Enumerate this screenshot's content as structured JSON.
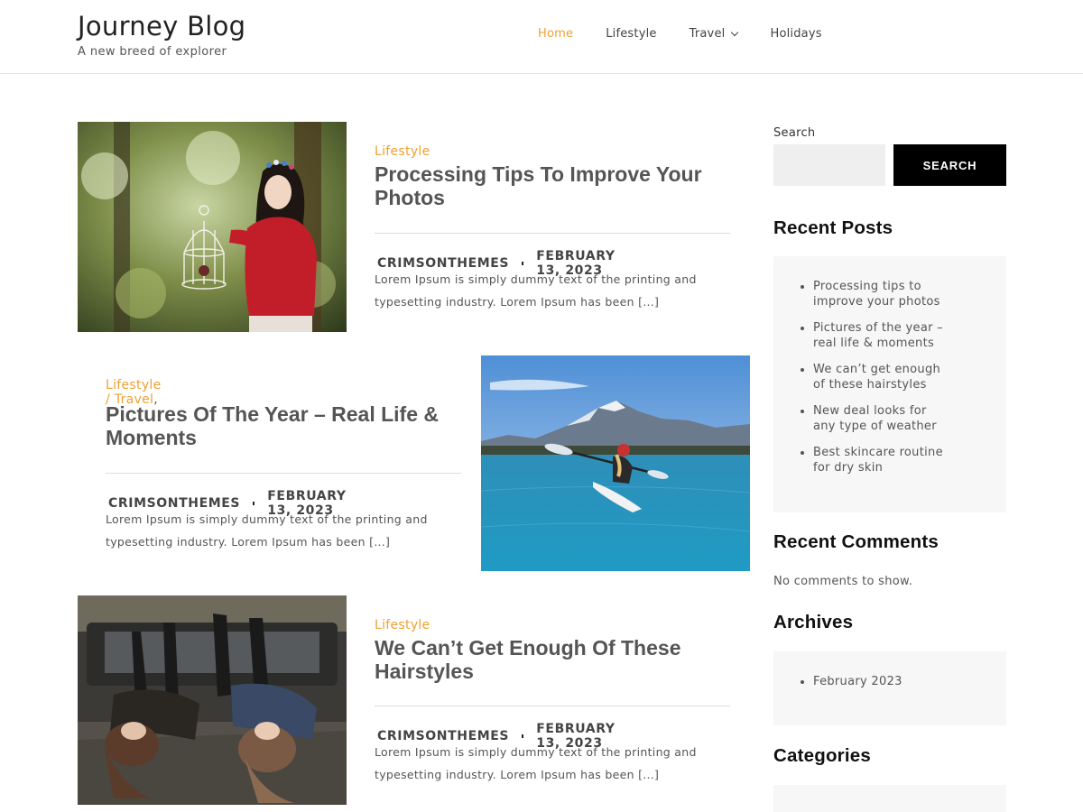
{
  "header": {
    "site_title": "Journey Blog",
    "tagline": "A new breed of explorer",
    "nav": [
      {
        "label": "Home",
        "active": true
      },
      {
        "label": "Lifestyle"
      },
      {
        "label": "Travel",
        "has_dropdown": true
      },
      {
        "label": "Holidays"
      }
    ],
    "accent_color": "#f0a030"
  },
  "posts": [
    {
      "categories": [
        "Lifestyle"
      ],
      "title": "Processing Tips To Improve Your Photos",
      "author": "CRIMSONTHEMES",
      "date": "FEBRUARY 13, 2023",
      "excerpt": "Lorem Ipsum is simply dummy text of the printing and typesetting industry. Lorem Ipsum has been […]",
      "image": "girl-with-birdcage-forest"
    },
    {
      "categories": [
        "Lifestyle",
        "Travel"
      ],
      "category_separator": " / ",
      "category_trailing": ",",
      "title": "Pictures Of The Year – Real Life & Moments",
      "author": "CRIMSONTHEMES",
      "date": "FEBRUARY 13, 2023",
      "excerpt": "Lorem Ipsum is simply dummy text of the printing and typesetting industry. Lorem Ipsum has been […]",
      "image": "kayak-mountain-lake"
    },
    {
      "categories": [
        "Lifestyle"
      ],
      "title": "We Can’t Get Enough Of These Hairstyles",
      "author": "CRIMSONTHEMES",
      "date": "FEBRUARY 13, 2023",
      "excerpt": "Lorem Ipsum is simply dummy text of the printing and typesetting industry. Lorem Ipsum has been […]",
      "image": "two-women-lying-on-car"
    }
  ],
  "sidebar": {
    "search": {
      "label": "Search",
      "placeholder": "",
      "button_label": "SEARCH"
    },
    "recent_posts": {
      "heading": "Recent Posts",
      "items": [
        "Processing tips to improve your photos",
        "Pictures of the year – real life & moments",
        "We can’t get enough of these hairstyles",
        "New deal looks for any type of weather",
        "Best skincare routine for dry skin"
      ]
    },
    "recent_comments": {
      "heading": "Recent Comments",
      "empty_text": "No comments to show."
    },
    "archives": {
      "heading": "Archives",
      "items": [
        "February 2023"
      ]
    },
    "categories": {
      "heading": "Categories"
    }
  }
}
